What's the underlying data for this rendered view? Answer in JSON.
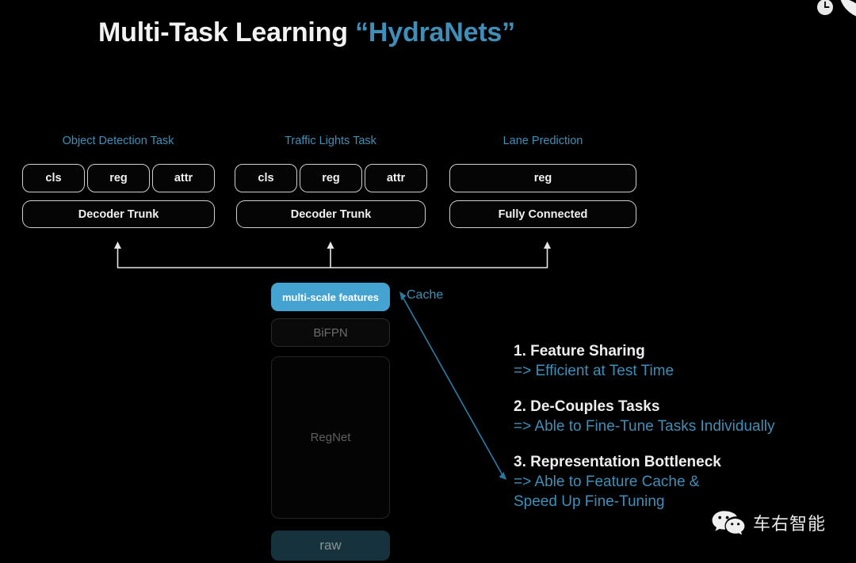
{
  "slide": {
    "background_color": "#000000",
    "accent_color": "#3f8fb8",
    "highlight_color": "#45a3d1",
    "title_main": "Multi-Task Learning ",
    "title_accent": "“HydraNets”"
  },
  "decorations": {
    "clock_icon": "clock-icon",
    "leaf_icon": "leaf-shape"
  },
  "tasks": [
    {
      "label": "Object Detection Task",
      "heads": [
        "cls",
        "reg",
        "attr"
      ],
      "trunk": "Decoder Trunk"
    },
    {
      "label": "Traffic Lights Task",
      "heads": [
        "cls",
        "reg",
        "attr"
      ],
      "trunk": "Decoder Trunk"
    },
    {
      "label": "Lane Prediction",
      "heads": [
        "reg"
      ],
      "trunk": "Fully Connected"
    }
  ],
  "backbone": {
    "multi_scale_features": "multi-scale features",
    "bifpn": "BiFPN",
    "regnet": "RegNet",
    "raw": "raw",
    "cache_label": "Cache"
  },
  "bullets": [
    {
      "head": "1. Feature Sharing",
      "sub1": "=> Efficient at Test Time",
      "sub2": ""
    },
    {
      "head": "2. De-Couples Tasks",
      "sub1": "=> Able to Fine-Tune Tasks Individually",
      "sub2": ""
    },
    {
      "head": "3. Representation Bottleneck",
      "sub1": "=> Able to Feature Cache &",
      "sub2": "Speed Up Fine-Tuning"
    }
  ],
  "watermark": {
    "logo": "wechat-logo",
    "text": "车右智能"
  }
}
